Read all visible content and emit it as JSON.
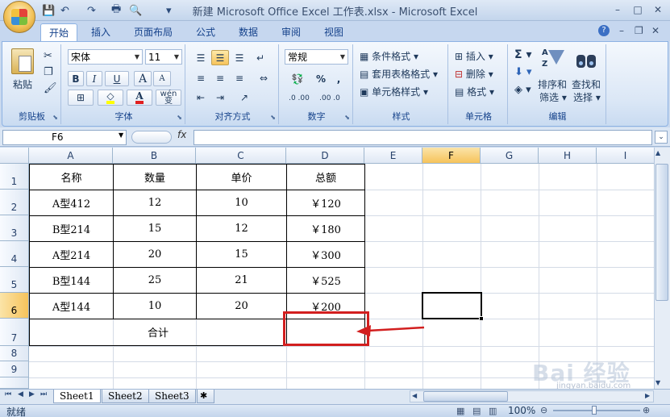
{
  "window": {
    "title": "新建 Microsoft Office Excel 工作表.xlsx - Microsoft Excel",
    "min": "–",
    "max": "□",
    "close": "✕"
  },
  "qat": {
    "save": "💾",
    "undo": "↶",
    "redo": "↷",
    "print": "🖶",
    "preview": "🔍",
    "more": "▾"
  },
  "tabs": [
    "开始",
    "插入",
    "页面布局",
    "公式",
    "数据",
    "审阅",
    "视图"
  ],
  "ribbon_controls": {
    "help": "?",
    "min": "–",
    "restore": "❐",
    "close": "✕"
  },
  "ribbon": {
    "clipboard": {
      "label": "剪贴板",
      "paste": "粘贴"
    },
    "font": {
      "label": "字体",
      "name": "宋体",
      "size": "11",
      "bold": "B",
      "italic": "I",
      "underline": "U",
      "grow": "A",
      "shrink": "A",
      "wen": "wén",
      "phonetic": "变"
    },
    "alignment": {
      "label": "对齐方式"
    },
    "number": {
      "label": "数字",
      "format": "常规",
      "percent": "%",
      "comma": ",",
      "inc": ".0 .00",
      "dec": ".00 .0"
    },
    "styles": {
      "label": "样式",
      "conditional": "条件格式",
      "table": "套用表格格式",
      "cell": "单元格样式"
    },
    "cells": {
      "label": "单元格",
      "insert": "插入",
      "delete": "删除",
      "format": "格式"
    },
    "editing": {
      "label": "编辑",
      "sort": "排序和",
      "filter": "筛选",
      "find": "查找和",
      "select": "选择"
    }
  },
  "formula_bar": {
    "name_box": "F6",
    "fx": "fx"
  },
  "columns": [
    "A",
    "B",
    "C",
    "D",
    "E",
    "F",
    "G",
    "H",
    "I"
  ],
  "rows": [
    "1",
    "2",
    "3",
    "4",
    "5",
    "6",
    "7",
    "8",
    "9"
  ],
  "table": {
    "headers": [
      "名称",
      "数量",
      "单价",
      "总额"
    ],
    "rows": [
      [
        "A型412",
        "12",
        "10",
        "￥120"
      ],
      [
        "B型214",
        "15",
        "12",
        "￥180"
      ],
      [
        "A型214",
        "20",
        "15",
        "￥300"
      ],
      [
        "B型144",
        "25",
        "21",
        "￥525"
      ],
      [
        "A型144",
        "10",
        "20",
        "￥200"
      ]
    ],
    "total_label": "合计"
  },
  "sheets": [
    "Sheet1",
    "Sheet2",
    "Sheet3"
  ],
  "status": {
    "ready": "就绪",
    "zoom": "100%"
  },
  "watermark": {
    "text": "Bai 经验",
    "url": "jingyan.baidu.com"
  },
  "colors": {
    "highlight": "#d21f1f",
    "accent": "#15428b"
  }
}
